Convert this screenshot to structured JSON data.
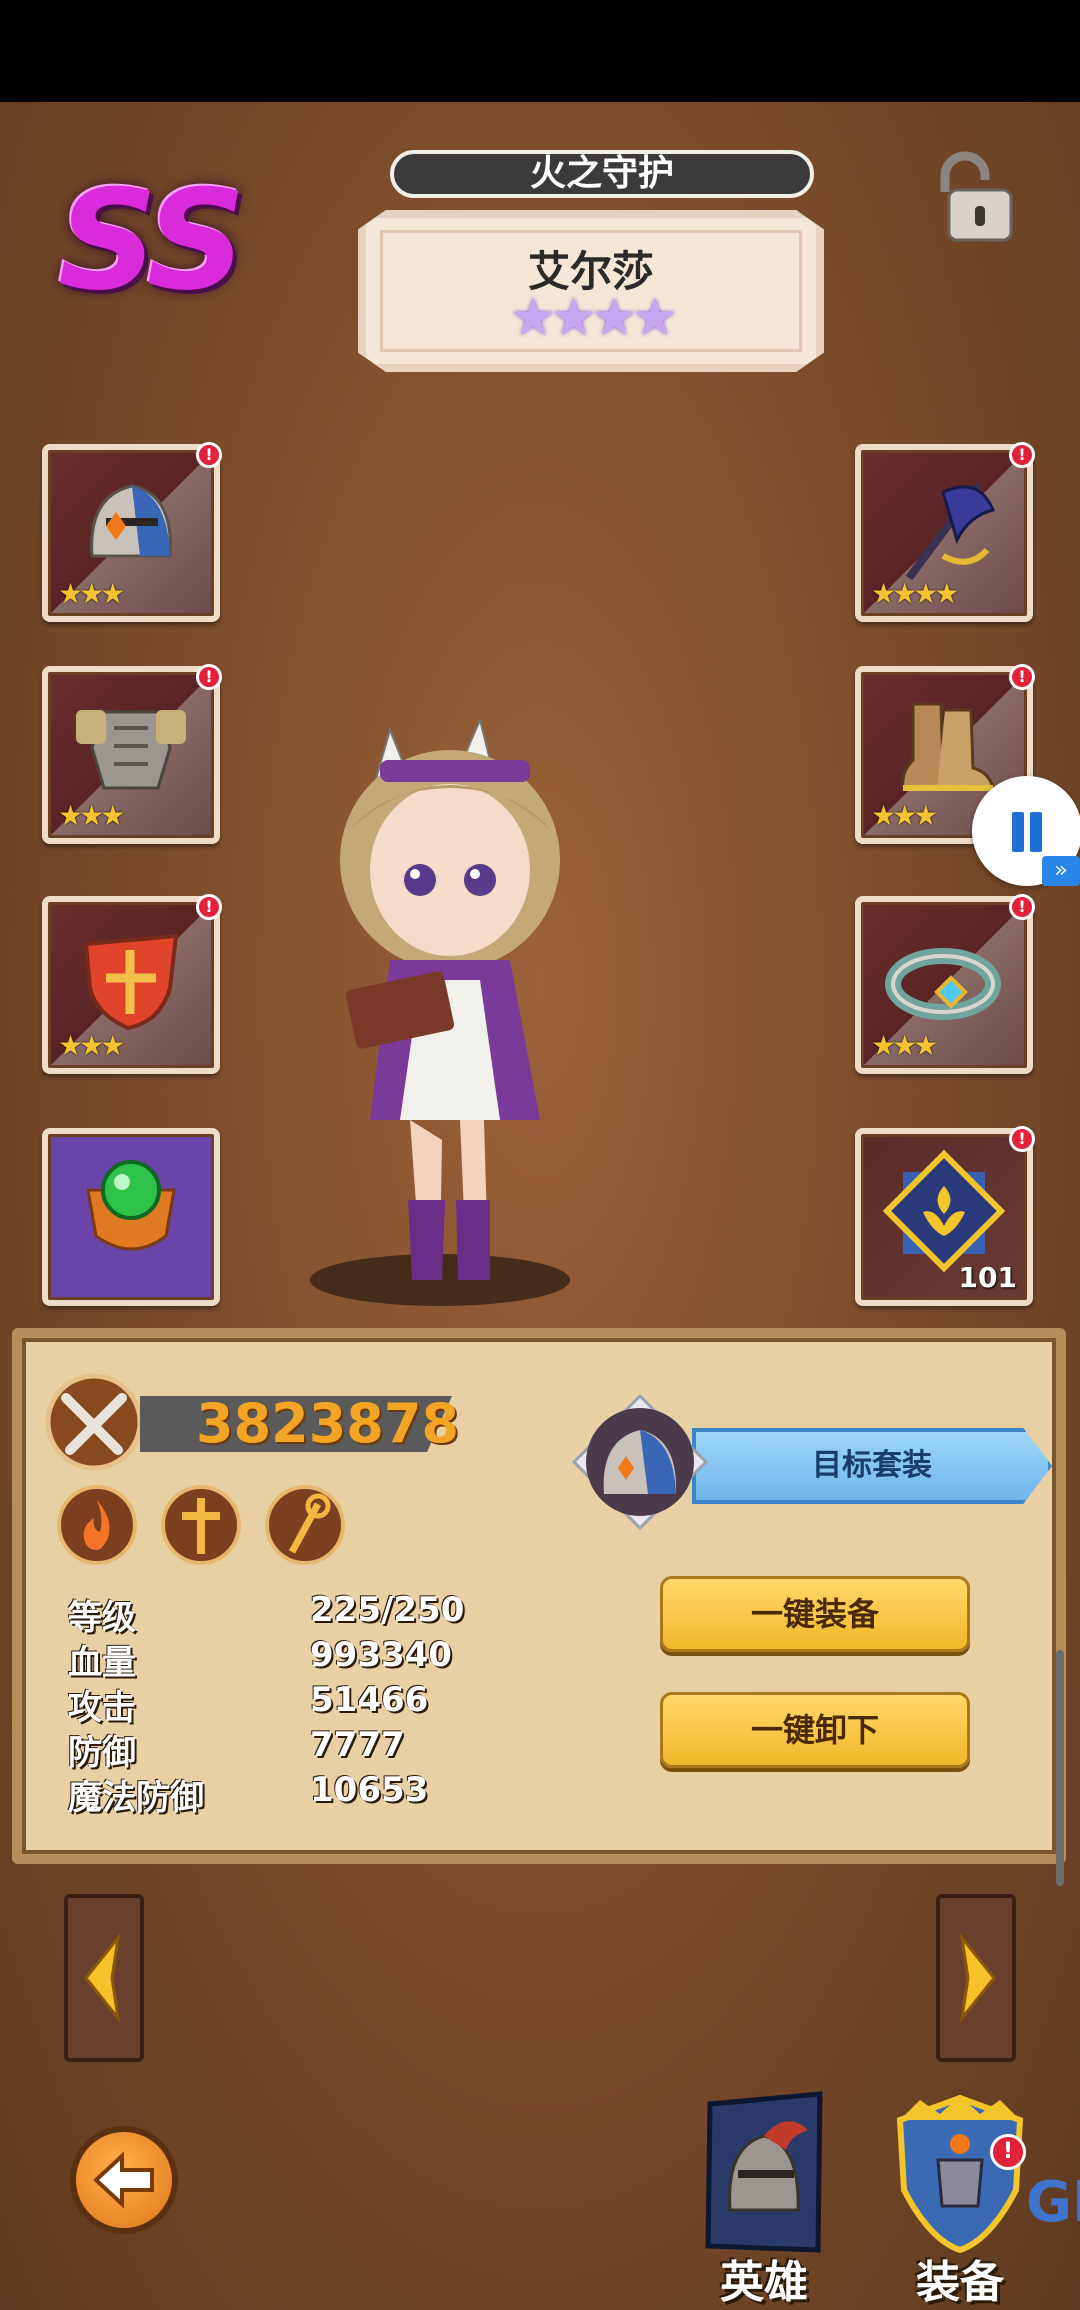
{
  "header": {
    "rank": "SS",
    "set_title": "火之守护",
    "hero_name": "艾尔莎",
    "hero_stars": 4,
    "lock_icon": "lock-open-icon"
  },
  "equipment_left": [
    {
      "item": "helmet-icon",
      "stars": 3,
      "alert": true
    },
    {
      "item": "armor-icon",
      "stars": 3,
      "alert": true
    },
    {
      "item": "shield-icon",
      "stars": 3,
      "alert": true
    },
    {
      "item": "green-orb-emblem-icon",
      "stars": 0,
      "alert": false
    }
  ],
  "equipment_right": [
    {
      "item": "axe-weapon-icon",
      "stars": 4,
      "alert": true
    },
    {
      "item": "boots-icon",
      "stars": 3,
      "alert": true
    },
    {
      "item": "bracelet-icon",
      "stars": 3,
      "alert": true
    },
    {
      "item": "rune-crest-icon",
      "count": "101",
      "alert": true
    }
  ],
  "alert_mark": "!",
  "panel": {
    "combat_power": "3823878",
    "target_set_label": "目标套装",
    "equip_all_label": "一键装备",
    "unequip_all_label": "一键卸下",
    "stats": [
      {
        "label": "等级",
        "value": "225/250"
      },
      {
        "label": "血量",
        "value": "993340"
      },
      {
        "label": "攻击",
        "value": "51466"
      },
      {
        "label": "防御",
        "value": "7777"
      },
      {
        "label": "魔法防御",
        "value": "10653"
      }
    ]
  },
  "nav": {
    "hero_label": "英雄",
    "equip_label": "装备",
    "watermark": "GK"
  },
  "colors": {
    "rank": "#d92bd9",
    "power": "#f3a424",
    "target_button": "#7fc4f0",
    "gold_button": "#f5c640",
    "alert": "#e2213a"
  }
}
